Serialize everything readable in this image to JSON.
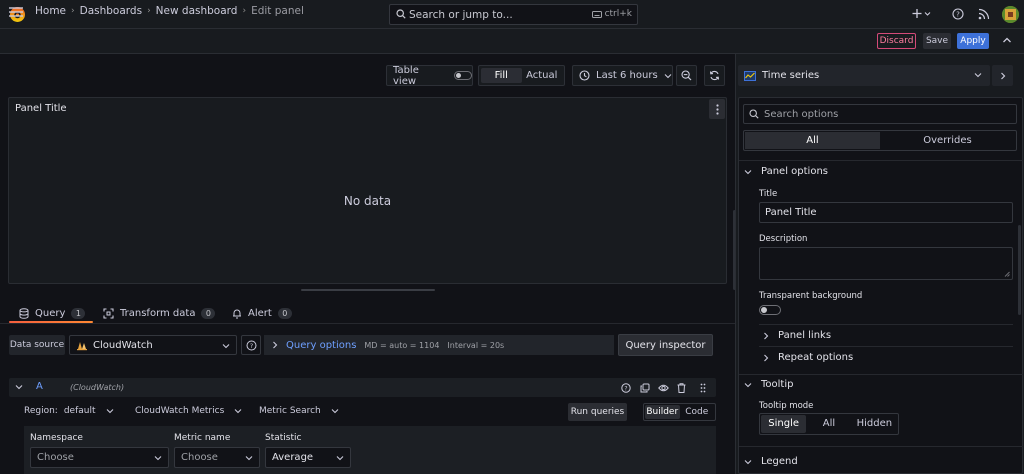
{
  "topbar": {
    "search_placeholder": "Search or jump to...",
    "search_shortcut": "ctrl+k",
    "plus_icon": "plus-icon",
    "help_icon": "help-icon",
    "news_icon": "rss-icon"
  },
  "breadcrumb": {
    "items": [
      "Home",
      "Dashboards",
      "New dashboard"
    ],
    "current": "Edit panel"
  },
  "actions": {
    "discard": "Discard",
    "save": "Save",
    "apply": "Apply"
  },
  "toolbar": {
    "table_view": "Table view",
    "fill": "Fill",
    "actual": "Actual",
    "time_range": "Last 6 hours"
  },
  "panel": {
    "title": "Panel Title",
    "no_data": "No data"
  },
  "tabs": [
    {
      "label": "Query",
      "count": "1"
    },
    {
      "label": "Transform data",
      "count": "0"
    },
    {
      "label": "Alert",
      "count": "0"
    }
  ],
  "query": {
    "datasource_label": "Data source",
    "datasource": "CloudWatch",
    "options_link": "Query options",
    "md": "MD = auto = 1104",
    "interval": "Interval = 20s",
    "inspector": "Query inspector",
    "row": {
      "ref_id": "A",
      "ds_name": "(CloudWatch)"
    },
    "region_label": "Region:",
    "region_value": "default",
    "metrics_type": "CloudWatch Metrics",
    "search_type": "Metric Search",
    "run": "Run queries",
    "builder": "Builder",
    "code": "Code",
    "namespace_label": "Namespace",
    "namespace_value": "Choose",
    "metric_label": "Metric name",
    "metric_value": "Choose",
    "statistic_label": "Statistic",
    "statistic_value": "Average"
  },
  "options": {
    "viz": "Time series",
    "search_placeholder": "Search options",
    "tab_all": "All",
    "tab_overrides": "Overrides",
    "panel_options": "Panel options",
    "title_label": "Title",
    "title_value": "Panel Title",
    "description_label": "Description",
    "transparent_label": "Transparent background",
    "panel_links": "Panel links",
    "repeat_options": "Repeat options",
    "tooltip": "Tooltip",
    "tooltip_mode_label": "Tooltip mode",
    "modes": [
      "Single",
      "All",
      "Hidden"
    ],
    "legend": "Legend"
  },
  "colors": {
    "accent_blue": "#3d71d9",
    "link_blue": "#6e9fff",
    "discard_pink": "#ff7c9f",
    "tab_orange": "#f55f3e"
  }
}
